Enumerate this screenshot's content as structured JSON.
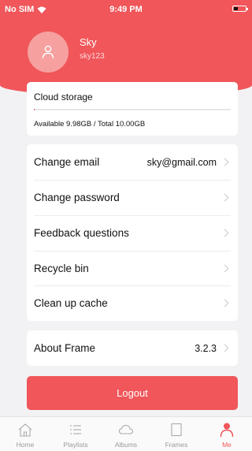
{
  "status_bar": {
    "carrier": "No SIM",
    "time": "9:49 PM"
  },
  "profile": {
    "name": "Sky",
    "username": "sky123"
  },
  "storage": {
    "title": "Cloud storage",
    "info": "Available 9.98GB / Total 10.00GB",
    "used_fraction": 0.002
  },
  "menu": {
    "items": [
      {
        "label": "Change email",
        "value": "sky@gmail.com"
      },
      {
        "label": "Change password",
        "value": ""
      },
      {
        "label": "Feedback questions",
        "value": ""
      },
      {
        "label": "Recycle bin",
        "value": ""
      },
      {
        "label": "Clean up cache",
        "value": ""
      }
    ]
  },
  "about": {
    "label": "About Frame",
    "value": "3.2.3"
  },
  "logout_label": "Logout",
  "tabs": [
    {
      "label": "Home",
      "icon": "home-icon"
    },
    {
      "label": "Playlists",
      "icon": "playlists-icon"
    },
    {
      "label": "Albums",
      "icon": "cloud-icon"
    },
    {
      "label": "Frames",
      "icon": "frame-icon"
    },
    {
      "label": "Me",
      "icon": "person-icon"
    }
  ],
  "colors": {
    "accent": "#f0565a",
    "background": "#f2f2f4",
    "inactive_tab": "#999999"
  }
}
